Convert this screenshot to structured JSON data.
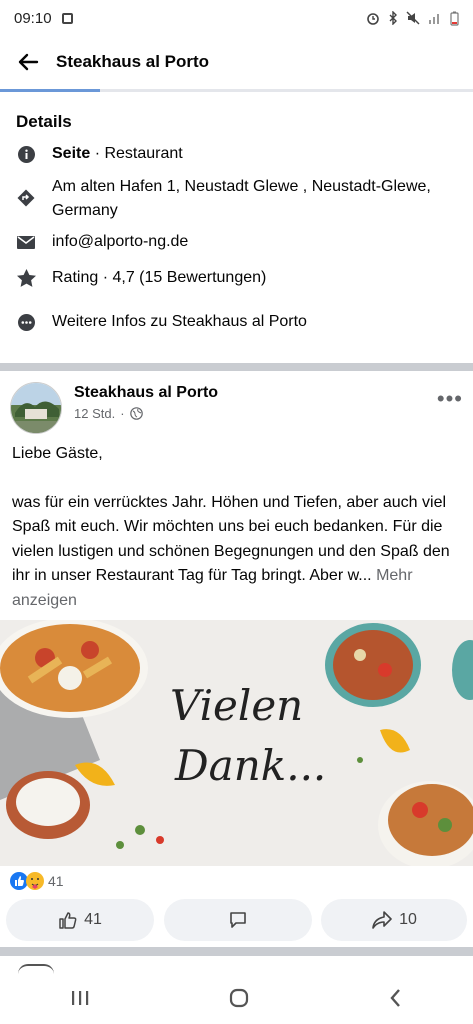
{
  "status": {
    "time": "09:10"
  },
  "header": {
    "title": "Steakhaus al Porto"
  },
  "details": {
    "heading": "Details",
    "category_label": "Seite",
    "category_sep": " · ",
    "category_value": "Restaurant",
    "address": "Am alten Hafen 1, Neustadt Glewe , Neustadt-Glewe, Germany",
    "email": "info@alporto-ng.de",
    "rating": "Rating · 4,7 (15 Bewertungen)",
    "more_info": "Weitere Infos zu Steakhaus al Porto"
  },
  "post": {
    "author": "Steakhaus al Porto",
    "time": "12 Std.",
    "meta_sep": "·",
    "greeting": "Liebe Gäste,",
    "body": "was für ein verrücktes Jahr. Höhen und Tiefen, aber auch viel Spaß mit euch. Wir möchten uns bei euch bedanken. Für die vielen lustigen und schönen Begegnungen und den Spaß den ihr in unser Restaurant Tag für Tag bringt. Aber w...",
    "more_label": "Mehr anzeigen",
    "image_text_line1": "Vielen",
    "image_text_line2": "Dank...",
    "reaction_count": "41",
    "like_count": "41",
    "share_count": "10"
  },
  "colors": {
    "link": "#216fdb",
    "accent": "#1877f2",
    "separator": "#c9ccd1"
  },
  "icons": [
    "back-arrow-icon",
    "info-icon",
    "directions-icon",
    "mail-icon",
    "star-icon",
    "more-dots-icon",
    "globe-icon",
    "like-icon",
    "comment-icon",
    "share-icon",
    "recents-icon",
    "home-icon",
    "back-nav-icon"
  ]
}
